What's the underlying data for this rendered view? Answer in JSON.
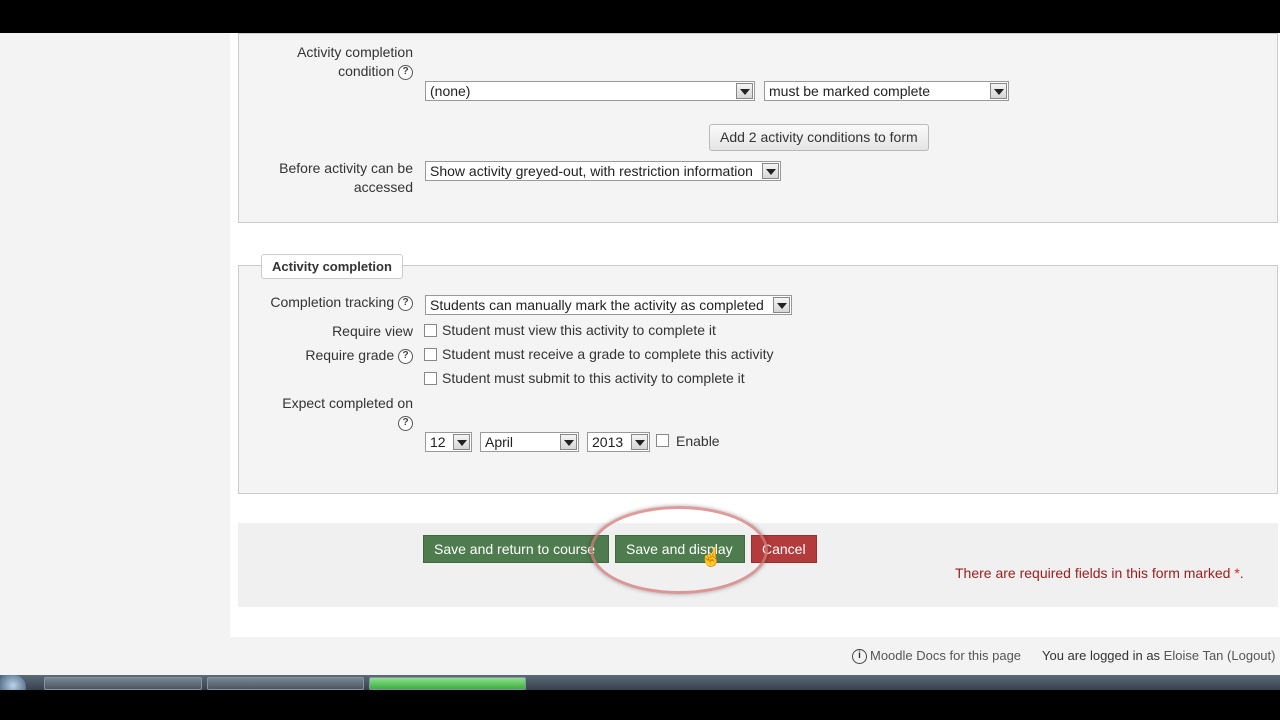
{
  "restrict_access": {
    "activity_completion_condition": {
      "label_line1": "Activity completion",
      "label_line2": "condition",
      "activity_select": "(none)",
      "condition_select": "must be marked complete"
    },
    "add_conditions_button": "Add 2 activity conditions to form",
    "before_accessed": {
      "label_line1": "Before activity can be",
      "label_line2": "accessed",
      "value": "Show activity greyed-out, with restriction information"
    }
  },
  "activity_completion": {
    "legend": "Activity completion",
    "tracking": {
      "label": "Completion tracking",
      "value": "Students can manually mark the activity as completed"
    },
    "require_view": {
      "label": "Require view",
      "option": "Student must view this activity to complete it",
      "checked": false
    },
    "require_grade": {
      "label": "Require grade",
      "option": "Student must receive a grade to complete this activity",
      "checked": false
    },
    "require_submit": {
      "option": "Student must submit to this activity to complete it",
      "checked": false
    },
    "expect_completed": {
      "label": "Expect completed on",
      "day": "12",
      "month": "April",
      "year": "2013",
      "enable_label": "Enable",
      "enabled": false
    }
  },
  "actions": {
    "save_return": "Save and return to course",
    "save_display": "Save and display",
    "cancel": "Cancel"
  },
  "required_note": {
    "text": "There are required fields in this form marked ",
    "star": "*",
    "end": "."
  },
  "footer": {
    "docs_link": "Moodle Docs for this page",
    "logged_in_prefix": "You are logged in as ",
    "user_name": "Eloise Tan",
    "logout": "(Logout)"
  },
  "icons": {
    "help": "question-circle-icon",
    "info": "info-circle-icon"
  },
  "colors": {
    "save_button": "#4e7c4e",
    "cancel_button": "#b33b3b",
    "required_text": "#9c1c1c",
    "highlight_ring": "#d67878"
  }
}
